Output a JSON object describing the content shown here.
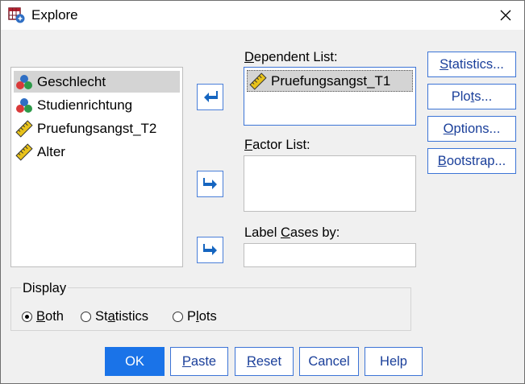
{
  "window": {
    "title": "Explore"
  },
  "source_list": {
    "items": [
      {
        "label": "Geschlecht",
        "icon": "nominal-variable-icon",
        "selected": true
      },
      {
        "label": "Studienrichtung",
        "icon": "nominal-variable-icon",
        "selected": false
      },
      {
        "label": "Pruefungsangst_T2",
        "icon": "scale-variable-icon",
        "selected": false
      },
      {
        "label": "Alter",
        "icon": "scale-variable-icon",
        "selected": false
      }
    ]
  },
  "dependent_list": {
    "label_pre": "",
    "label_mnemonic": "D",
    "label_post": "ependent List:",
    "items": [
      {
        "label": "Pruefungsangst_T1",
        "icon": "scale-variable-icon"
      }
    ]
  },
  "factor_list": {
    "label_pre": "",
    "label_mnemonic": "F",
    "label_post": "actor List:"
  },
  "label_cases": {
    "label_pre": "Label ",
    "label_mnemonic": "C",
    "label_post": "ases by:"
  },
  "side_buttons": {
    "statistics": {
      "pre": "",
      "mn": "S",
      "post": "tatistics..."
    },
    "plots": {
      "pre": "Plo",
      "mn": "t",
      "post": "s..."
    },
    "options": {
      "pre": "",
      "mn": "O",
      "post": "ptions..."
    },
    "bootstrap": {
      "pre": "",
      "mn": "B",
      "post": "ootstrap..."
    }
  },
  "display": {
    "label": "Display",
    "options": [
      {
        "pre": "",
        "mn": "B",
        "post": "oth",
        "checked": true
      },
      {
        "pre": "St",
        "mn": "a",
        "post": "tistics",
        "checked": false
      },
      {
        "pre": "P",
        "mn": "l",
        "post": "ots",
        "checked": false
      }
    ]
  },
  "bottom_buttons": {
    "ok": "OK",
    "paste": {
      "pre": "",
      "mn": "P",
      "post": "aste"
    },
    "reset": {
      "pre": "",
      "mn": "R",
      "post": "eset"
    },
    "cancel": "Cancel",
    "help": "Help"
  },
  "colors": {
    "accent": "#1a73e8",
    "button_text": "#1a3f9a",
    "arrow": "#1565c0"
  }
}
